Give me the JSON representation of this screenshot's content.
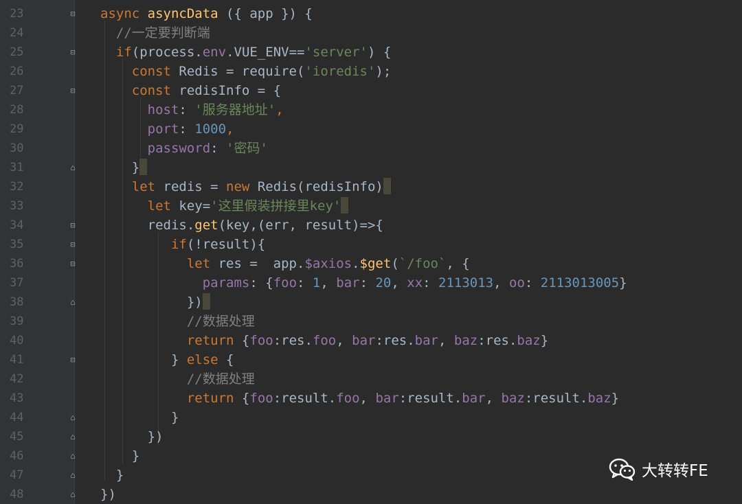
{
  "editor": {
    "theme": "dark",
    "colors": {
      "background": "#2b2b2b",
      "gutter": "#313335",
      "keyword": "#cc7832",
      "function": "#ffc66d",
      "string": "#6a8759",
      "property": "#9876aa",
      "number": "#6897bb",
      "comment": "#808080",
      "text": "#a9b7c6"
    },
    "lines": [
      {
        "n": "23",
        "fold": "open",
        "tokens": [
          [
            "kw",
            "async "
          ],
          [
            "fn",
            "asyncData"
          ],
          [
            "plain",
            " ({ app }) {"
          ]
        ]
      },
      {
        "n": "24",
        "fold": "",
        "tokens": [
          [
            "plain",
            "  "
          ],
          [
            "cm",
            "//一定要判断端"
          ]
        ]
      },
      {
        "n": "25",
        "fold": "open",
        "tokens": [
          [
            "plain",
            "  "
          ],
          [
            "kw",
            "if"
          ],
          [
            "plain",
            "(process."
          ],
          [
            "prop",
            "env"
          ],
          [
            "plain",
            ".VUE_ENV=="
          ],
          [
            "str",
            "'server'"
          ],
          [
            "plain",
            ") {"
          ]
        ]
      },
      {
        "n": "26",
        "fold": "",
        "tokens": [
          [
            "plain",
            "    "
          ],
          [
            "kw",
            "const "
          ],
          [
            "plain",
            "Redis = require("
          ],
          [
            "str",
            "'ioredis'"
          ],
          [
            "plain",
            ");"
          ]
        ]
      },
      {
        "n": "27",
        "fold": "open",
        "tokens": [
          [
            "plain",
            "    "
          ],
          [
            "kw",
            "const "
          ],
          [
            "plain",
            "redisInfo = {"
          ]
        ]
      },
      {
        "n": "28",
        "fold": "",
        "tokens": [
          [
            "plain",
            "      "
          ],
          [
            "prop",
            "host"
          ],
          [
            "plain",
            ": "
          ],
          [
            "str",
            "'服务器地址'"
          ],
          [
            "kw",
            ","
          ]
        ]
      },
      {
        "n": "29",
        "fold": "",
        "tokens": [
          [
            "plain",
            "      "
          ],
          [
            "prop",
            "port"
          ],
          [
            "plain",
            ": "
          ],
          [
            "numv",
            "1000"
          ],
          [
            "kw",
            ","
          ]
        ]
      },
      {
        "n": "30",
        "fold": "",
        "tokens": [
          [
            "plain",
            "      "
          ],
          [
            "prop",
            "password"
          ],
          [
            "plain",
            ": "
          ],
          [
            "str",
            "'密码'"
          ]
        ]
      },
      {
        "n": "31",
        "fold": "close",
        "tokens": [
          [
            "plain",
            "    }"
          ]
        ],
        "caret": true
      },
      {
        "n": "32",
        "fold": "",
        "tokens": [
          [
            "plain",
            "    "
          ],
          [
            "kw",
            "let "
          ],
          [
            "plain",
            "redis = "
          ],
          [
            "kw",
            "new "
          ],
          [
            "plain",
            "Redis(redisInfo)"
          ]
        ],
        "caret": true
      },
      {
        "n": "33",
        "fold": "",
        "tokens": [
          [
            "plain",
            "      "
          ],
          [
            "kw",
            "let "
          ],
          [
            "plain",
            "key="
          ],
          [
            "str",
            "'这里假装拼接里key'"
          ]
        ],
        "caret": true
      },
      {
        "n": "34",
        "fold": "open",
        "tokens": [
          [
            "plain",
            "      redis."
          ],
          [
            "fn",
            "get"
          ],
          [
            "plain",
            "(key,(err, result)=>{"
          ]
        ]
      },
      {
        "n": "35",
        "fold": "open",
        "tokens": [
          [
            "plain",
            "         "
          ],
          [
            "kw",
            "if"
          ],
          [
            "plain",
            "(!result){"
          ]
        ]
      },
      {
        "n": "36",
        "fold": "open",
        "tokens": [
          [
            "plain",
            "           "
          ],
          [
            "kw",
            "let "
          ],
          [
            "plain",
            "res =  app."
          ],
          [
            "prop",
            "$axios"
          ],
          [
            "plain",
            "."
          ],
          [
            "fn",
            "$get"
          ],
          [
            "plain",
            "("
          ],
          [
            "str",
            "`/foo`"
          ],
          [
            "plain",
            ", {"
          ]
        ]
      },
      {
        "n": "37",
        "fold": "",
        "tokens": [
          [
            "plain",
            "             "
          ],
          [
            "prop",
            "params"
          ],
          [
            "plain",
            ": {"
          ],
          [
            "prop",
            "foo"
          ],
          [
            "plain",
            ": "
          ],
          [
            "numv",
            "1"
          ],
          [
            "plain",
            ", "
          ],
          [
            "prop",
            "bar"
          ],
          [
            "plain",
            ": "
          ],
          [
            "numv",
            "20"
          ],
          [
            "plain",
            ", "
          ],
          [
            "prop",
            "xx"
          ],
          [
            "plain",
            ": "
          ],
          [
            "numv",
            "2113013"
          ],
          [
            "plain",
            ", "
          ],
          [
            "prop",
            "oo"
          ],
          [
            "plain",
            ": "
          ],
          [
            "numv",
            "2113013005"
          ],
          [
            "plain",
            "}"
          ]
        ]
      },
      {
        "n": "38",
        "fold": "close",
        "tokens": [
          [
            "plain",
            "           })"
          ]
        ],
        "caret": true
      },
      {
        "n": "39",
        "fold": "",
        "tokens": [
          [
            "plain",
            "           "
          ],
          [
            "cm",
            "//数据处理"
          ]
        ]
      },
      {
        "n": "40",
        "fold": "",
        "tokens": [
          [
            "plain",
            "           "
          ],
          [
            "kw",
            "return "
          ],
          [
            "plain",
            "{"
          ],
          [
            "prop",
            "foo"
          ],
          [
            "plain",
            ":res."
          ],
          [
            "prop",
            "foo"
          ],
          [
            "plain",
            ", "
          ],
          [
            "prop",
            "bar"
          ],
          [
            "plain",
            ":res."
          ],
          [
            "prop",
            "bar"
          ],
          [
            "plain",
            ", "
          ],
          [
            "prop",
            "baz"
          ],
          [
            "plain",
            ":res."
          ],
          [
            "prop",
            "baz"
          ],
          [
            "plain",
            "}"
          ]
        ]
      },
      {
        "n": "41",
        "fold": "open",
        "tokens": [
          [
            "plain",
            "         } "
          ],
          [
            "kw",
            "else "
          ],
          [
            "plain",
            "{"
          ]
        ]
      },
      {
        "n": "42",
        "fold": "",
        "tokens": [
          [
            "plain",
            "           "
          ],
          [
            "cm",
            "//数据处理"
          ]
        ]
      },
      {
        "n": "43",
        "fold": "",
        "tokens": [
          [
            "plain",
            "           "
          ],
          [
            "kw",
            "return "
          ],
          [
            "plain",
            "{"
          ],
          [
            "prop",
            "foo"
          ],
          [
            "plain",
            ":result."
          ],
          [
            "prop",
            "foo"
          ],
          [
            "plain",
            ", "
          ],
          [
            "prop",
            "bar"
          ],
          [
            "plain",
            ":result."
          ],
          [
            "prop",
            "bar"
          ],
          [
            "plain",
            ", "
          ],
          [
            "prop",
            "baz"
          ],
          [
            "plain",
            ":result."
          ],
          [
            "prop",
            "baz"
          ],
          [
            "plain",
            "}"
          ]
        ]
      },
      {
        "n": "44",
        "fold": "close",
        "tokens": [
          [
            "plain",
            "         }"
          ]
        ]
      },
      {
        "n": "45",
        "fold": "close",
        "tokens": [
          [
            "plain",
            "      })"
          ]
        ]
      },
      {
        "n": "46",
        "fold": "close",
        "tokens": [
          [
            "plain",
            "    }"
          ]
        ]
      },
      {
        "n": "47",
        "fold": "close",
        "tokens": [
          [
            "plain",
            "  }"
          ]
        ]
      },
      {
        "n": "48",
        "fold": "close",
        "tokens": [
          [
            "plain",
            "})"
          ]
        ]
      }
    ]
  },
  "watermark": {
    "label": "大转转FE",
    "icon": "wechat-icon"
  }
}
